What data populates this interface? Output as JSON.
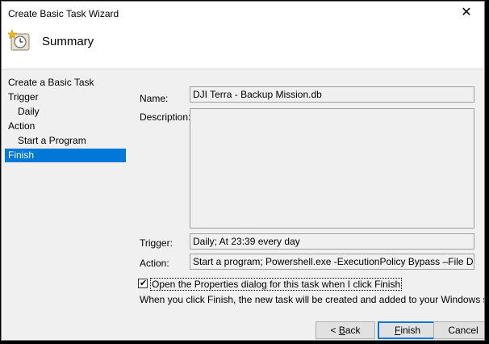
{
  "window": {
    "title": "Create Basic Task Wizard",
    "close_glyph": "✕",
    "icon": "task-scheduler-clock-icon"
  },
  "header": {
    "title": "Summary"
  },
  "sidebar": {
    "items": [
      {
        "label": "Create a Basic Task",
        "level": 0,
        "active": false
      },
      {
        "label": "Trigger",
        "level": 0,
        "active": false
      },
      {
        "label": "Daily",
        "level": 1,
        "active": false
      },
      {
        "label": "Action",
        "level": 0,
        "active": false
      },
      {
        "label": "Start a Program",
        "level": 1,
        "active": false
      },
      {
        "label": "Finish",
        "level": 0,
        "active": true
      }
    ]
  },
  "form": {
    "name_label": "Name:",
    "name_value": "DJI Terra - Backup Mission.db",
    "description_label": "Description:",
    "description_value": "",
    "trigger_label": "Trigger:",
    "trigger_value": "Daily; At 23:39 every day",
    "action_label": "Action:",
    "action_value": "Start a program; Powershell.exe -ExecutionPolicy Bypass –File D:\\DJICache\\PS"
  },
  "options": {
    "open_properties_label": "Open the Properties dialog for this task when I click Finish",
    "open_properties_checked": true,
    "info_text": "When you click Finish, the new task will be created and added to your Windows schedule."
  },
  "buttons": {
    "back_prefix": "< ",
    "back_mnemonic": "B",
    "back_rest": "ack",
    "finish_mnemonic": "F",
    "finish_rest": "inish",
    "cancel_label": "Cancel"
  },
  "colors": {
    "selection": "#0078d7",
    "background": "#f0f0f0"
  }
}
